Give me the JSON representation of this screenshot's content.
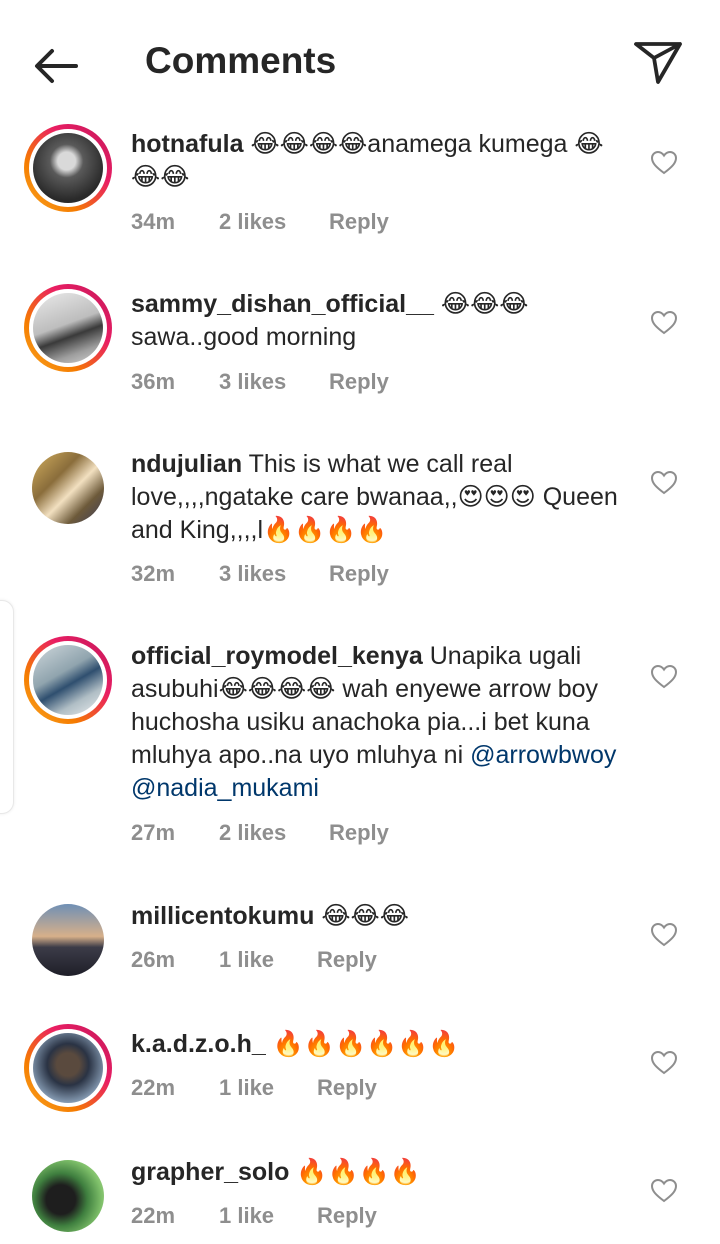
{
  "header": {
    "title": "Comments"
  },
  "comments": [
    {
      "username": "hotnafula",
      "body": " 😂😂😂😂anamega kumega 😂😂😂",
      "time": "34m",
      "likes": "2 likes",
      "reply": "Reply"
    },
    {
      "username": "sammy_dishan_official__",
      "body": " 😂😂😂 sawa..good morning",
      "time": "36m",
      "likes": "3 likes",
      "reply": "Reply"
    },
    {
      "username": "ndujulian",
      "body": " This is what we call real love,,,,ngatake care bwanaa,,😍😍😍 Queen and King,,,,l🔥🔥🔥🔥",
      "time": "32m",
      "likes": "3 likes",
      "reply": "Reply"
    },
    {
      "username": "official_roymodel_kenya",
      "body": " Unapika ugali asubuhi😂😂😂😂 wah enyewe arrow boy huchosha usiku anachoka pia...i bet kuna mluhya apo..na uyo mluhya ni ",
      "mention1": "@arrowbwoy",
      "mention2": "@nadia_mukami",
      "time": "27m",
      "likes": "2 likes",
      "reply": "Reply"
    },
    {
      "username": "millicentokumu",
      "body": " 😂😂😂",
      "time": "26m",
      "likes": "1 like",
      "reply": "Reply"
    },
    {
      "username": "k.a.d.z.o.h_",
      "body": " 🔥🔥🔥🔥🔥🔥",
      "time": "22m",
      "likes": "1 like",
      "reply": "Reply"
    },
    {
      "username": "grapher_solo",
      "body": " 🔥🔥🔥🔥",
      "time": "22m",
      "likes": "1 like",
      "reply": "Reply"
    }
  ]
}
